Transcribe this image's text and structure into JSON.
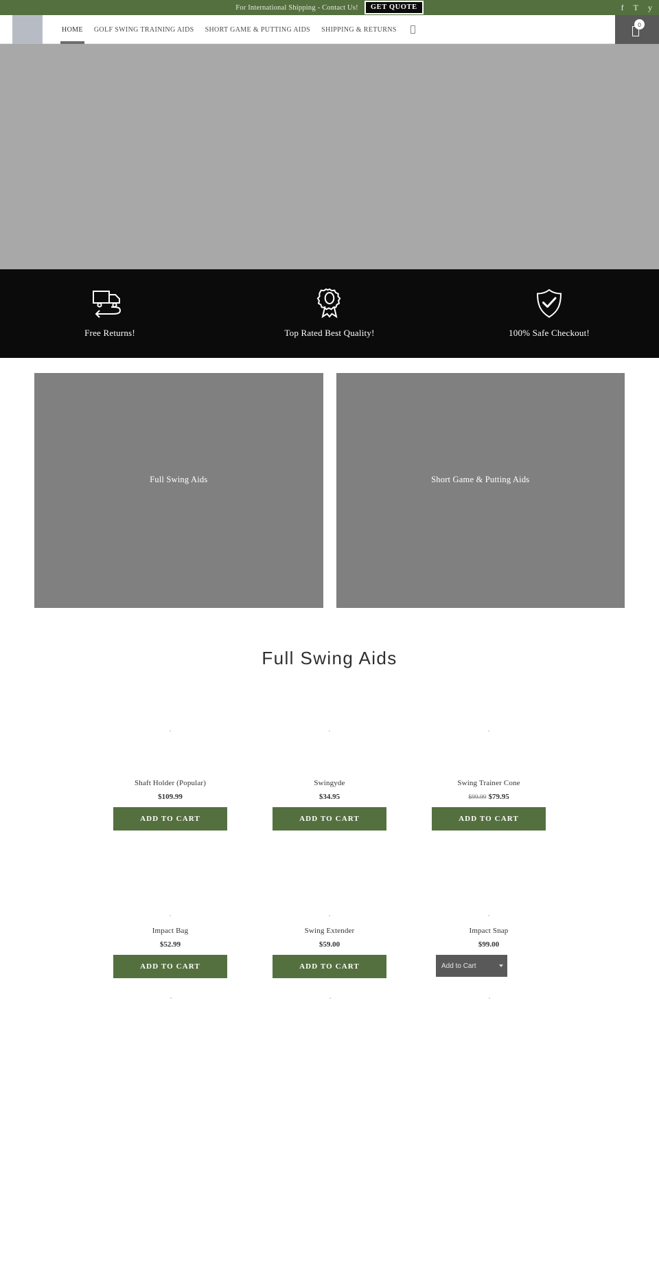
{
  "topbar": {
    "message": "For International Shipping - Contact Us!",
    "quote_button": "GET QUOTE",
    "social": [
      {
        "name": "facebook-icon",
        "glyph": "f"
      },
      {
        "name": "twitter-icon",
        "glyph": "T"
      },
      {
        "name": "youtube-icon",
        "glyph": "y"
      }
    ],
    "background_color": "#55703f"
  },
  "header": {
    "nav": [
      {
        "label": "HOME",
        "active": true
      },
      {
        "label": "GOLF SWING TRAINING AIDS",
        "active": false
      },
      {
        "label": "SHORT GAME & PUTTING AIDS",
        "active": false
      },
      {
        "label": "SHIPPING & RETURNS",
        "active": false
      }
    ],
    "search_icon": "search-icon",
    "cart_count": "0",
    "cart_background": "#595959"
  },
  "features": [
    {
      "icon": "return-truck-icon",
      "label": "Free Returns!"
    },
    {
      "icon": "award-ribbon-icon",
      "label": "Top Rated Best Quality!"
    },
    {
      "icon": "shield-check-icon",
      "label": "100% Safe Checkout!"
    }
  ],
  "tiles": [
    {
      "label": "Full Swing Aids"
    },
    {
      "label": "Short Game & Putting Aids"
    }
  ],
  "products_section": {
    "title": "Full Swing Aids",
    "accent_color": "#55703f",
    "products": [
      {
        "name": "Shaft Holder (Popular)",
        "price": "$109.99",
        "old_price": "",
        "cta": "ADD TO CART",
        "cta_type": "button"
      },
      {
        "name": "Swingyde",
        "price": "$34.95",
        "old_price": "",
        "cta": "ADD TO CART",
        "cta_type": "button"
      },
      {
        "name": "Swing Trainer Cone",
        "price": "$79.95",
        "old_price": "$99.99",
        "cta": "ADD TO CART",
        "cta_type": "button"
      },
      {
        "name": "Impact Bag",
        "price": "$52.99",
        "old_price": "",
        "cta": "ADD TO CART",
        "cta_type": "button"
      },
      {
        "name": "Swing Extender",
        "price": "$59.00",
        "old_price": "",
        "cta": "ADD TO CART",
        "cta_type": "button"
      },
      {
        "name": "Impact Snap",
        "price": "$99.00",
        "old_price": "",
        "cta": "Add to Cart",
        "cta_type": "select"
      }
    ]
  }
}
